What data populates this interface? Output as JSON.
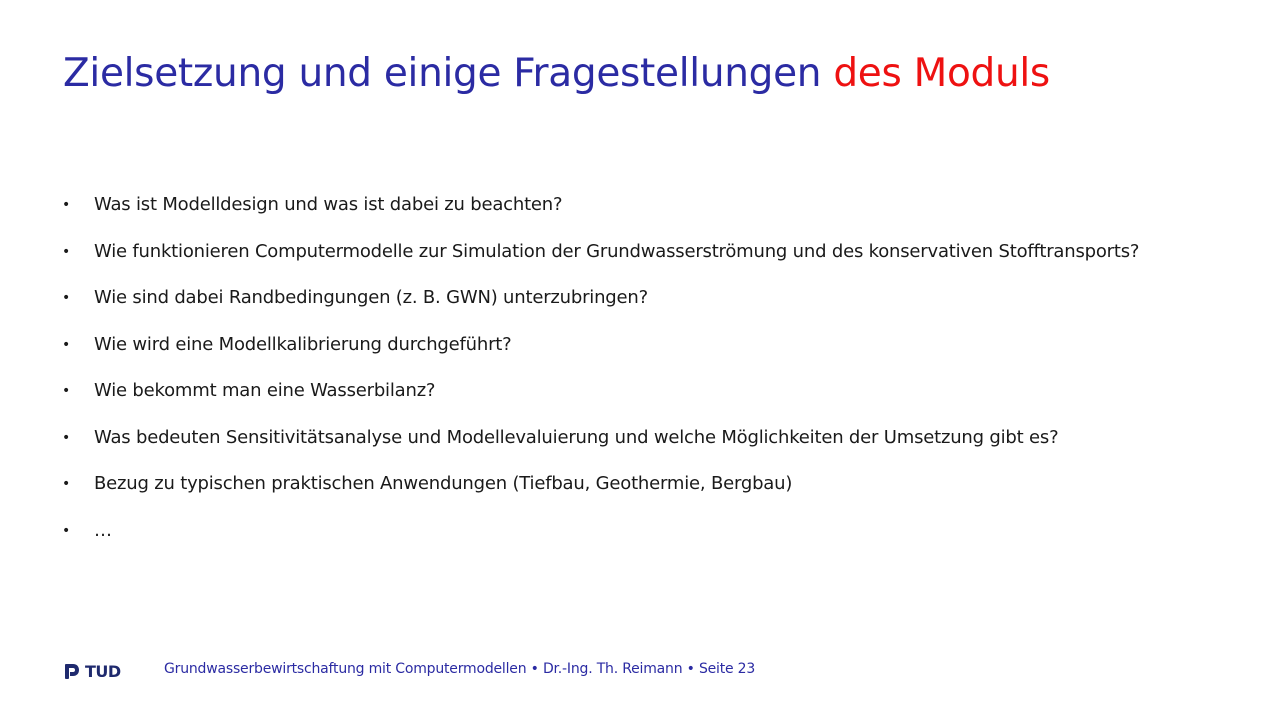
{
  "slide": {
    "title_main": "Zielsetzung und einige Fragestellungen",
    "title_accent": "des Moduls",
    "colors": {
      "title": "#2b2ba3",
      "accent": "#ee1111",
      "footer": "#2b2ba3",
      "logo": "#1f2a6e"
    }
  },
  "bullets": [
    {
      "text": "Was ist Modelldesign und was ist dabei zu beachten?"
    },
    {
      "text": "Wie funktionieren Computermodelle zur Simulation der Grundwasserströmung und des konservativen Stofftransports?"
    },
    {
      "text": "Wie sind dabei Randbedingungen (z. B. GWN) unterzubringen?"
    },
    {
      "text": "Wie wird eine Modellkalibrierung durchgeführt?"
    },
    {
      "text": "Wie bekommt man eine Wasserbilanz?"
    },
    {
      "text": "Was bedeuten Sensitivitätsanalyse und Modellevaluierung und welche Möglichkeiten der Umsetzung gibt es?"
    },
    {
      "text": "Bezug zu typischen praktischen Anwendungen (Tiefbau, Geothermie, Bergbau)"
    },
    {
      "text": "…"
    }
  ],
  "bullet_marker": "•",
  "footer": {
    "logo_text": "TUD",
    "logo_icon": "tud-logo-icon",
    "text": "Grundwasserbewirtschaftung mit Computermodellen • Dr.-Ing. Th. Reimann • Seite 23"
  }
}
